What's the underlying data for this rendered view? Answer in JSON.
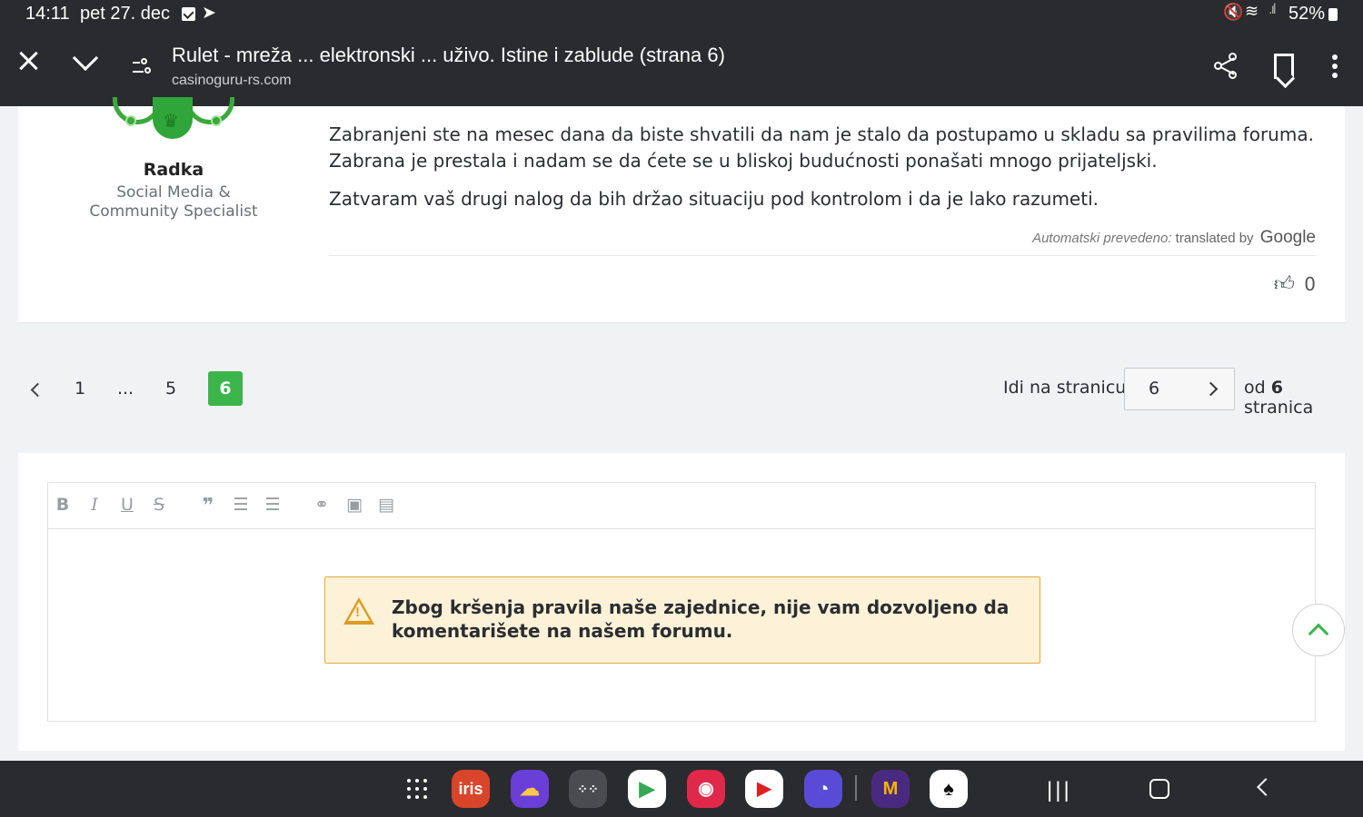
{
  "status_bar": {
    "time": "14:11",
    "date": "pet 27. dec",
    "battery": "52%"
  },
  "browser": {
    "page_title": "Rulet - mreža ... elektronski ... uživo. Istine i zablude (strana 6)",
    "url": "casinoguru-rs.com"
  },
  "post": {
    "author_name": "Radka",
    "author_role": "Social Media & Community Specialist",
    "paragraphs": [
      "Zabranjeni ste na mesec dana da biste shvatili da nam je stalo da postupamo u skladu sa pravilima foruma. Zabrana je prestala i nadam se da ćete se u bliskoj budućnosti ponašati mnogo prijateljski.",
      "Zatvaram vaš drugi nalog da bih držao situaciju pod kontrolom i da je lako razumeti."
    ],
    "translated_label": "Automatski prevedeno:",
    "translated_by": "translated by",
    "google": "Google",
    "likes": "0"
  },
  "pagination": {
    "pages": [
      "1",
      "...",
      "5",
      "6"
    ],
    "current": "6",
    "goto_label": "Idi na stranicu",
    "goto_value": "6",
    "of_prefix": "od",
    "total": "6",
    "of_suffix": "stranica"
  },
  "editor": {
    "toolbar": [
      "B",
      "I",
      "U",
      "S",
      "99",
      "ordered-list",
      "bullet-list",
      "link",
      "image",
      "video"
    ],
    "warning": "Zbog kršenja pravila naše zajednice, nije vam dozvoljeno da komentarišete na našem forumu."
  },
  "dock_apps": [
    "app-drawer",
    "iris",
    "weather",
    "apps-folder",
    "play-store",
    "camera",
    "youtube",
    "internet",
    "mozzart",
    "poker"
  ],
  "colors": {
    "accent": "#3bb54a",
    "warning_bg": "#fdf2d8",
    "warning_border": "#e5a93a",
    "system_bar": "#2a2b2e"
  }
}
